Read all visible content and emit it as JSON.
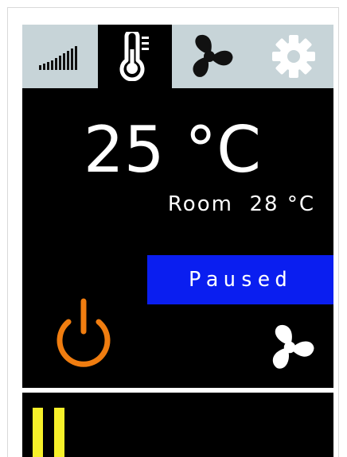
{
  "colors": {
    "tab_bar_bg": "#c7d4d8",
    "screen_bg": "#000000",
    "text": "#ffffff",
    "status_badge_bg": "#0a1ef0",
    "power_accent": "#f07d10",
    "pause_accent": "#f7f02a"
  },
  "tabs": [
    {
      "icon": "signal-bars-icon",
      "active": false
    },
    {
      "icon": "thermometer-icon",
      "active": true
    },
    {
      "icon": "fan-icon",
      "active": false
    },
    {
      "icon": "gear-icon",
      "active": false
    }
  ],
  "thermostat": {
    "setpoint": "25 °C",
    "room_label": "Room",
    "room_temp": "28 °C"
  },
  "status": {
    "label": "Paused"
  },
  "controls": {
    "power_icon": "power-icon",
    "fan_icon": "fan-icon",
    "pause_icon": "pause-icon"
  }
}
